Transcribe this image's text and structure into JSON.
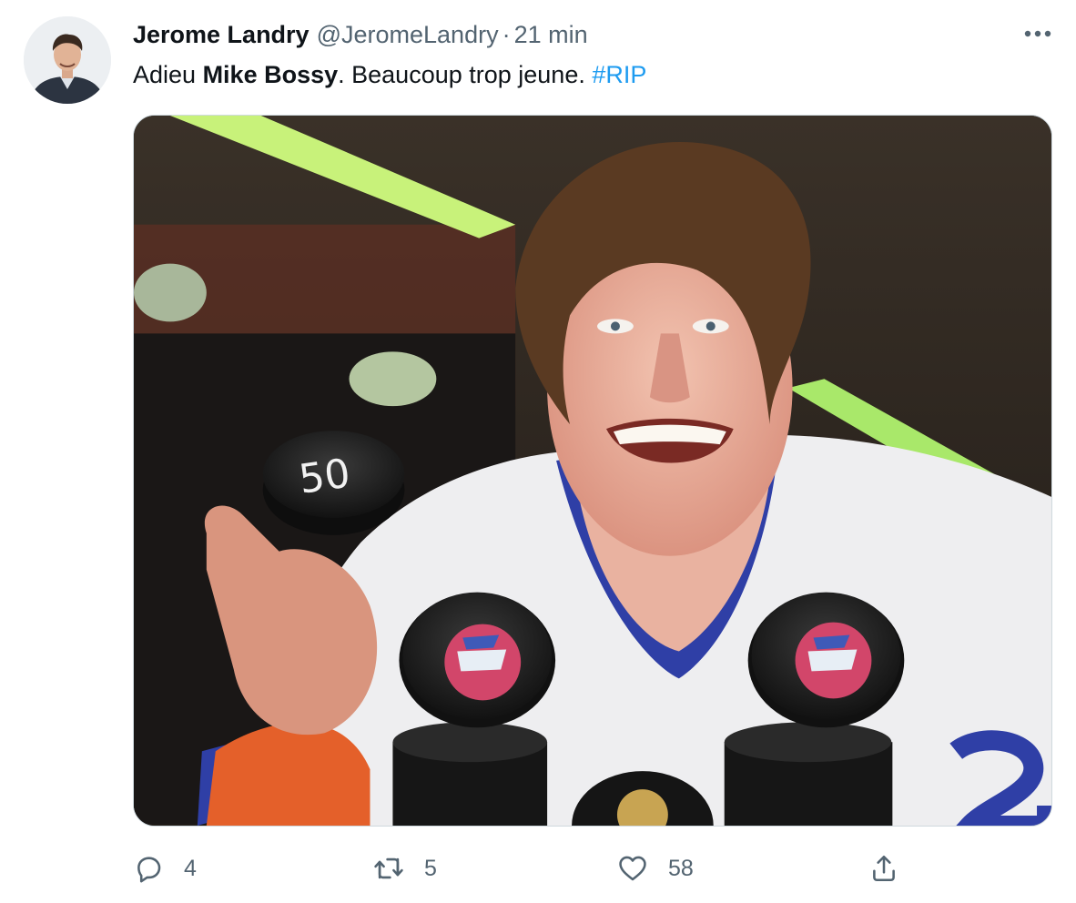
{
  "tweet": {
    "author_name": "Jerome Landry",
    "author_handle": "@JeromeLandry",
    "separator": "·",
    "time_ago": "21 min",
    "text_parts": {
      "before": "Adieu ",
      "bold": "Mike Bossy",
      "after": ". Beaucoup trop jeune. ",
      "hashtag": "#RIP"
    },
    "media": {
      "puck_label": "50"
    }
  },
  "actions": {
    "reply_count": "4",
    "retweet_count": "5",
    "like_count": "58"
  },
  "icons": {
    "more": "more-horizontal-icon",
    "reply": "reply-icon",
    "retweet": "retweet-icon",
    "like": "heart-icon",
    "share": "share-icon"
  },
  "colors": {
    "link": "#1d9bf0",
    "muted": "#536471",
    "text": "#0f1419"
  }
}
